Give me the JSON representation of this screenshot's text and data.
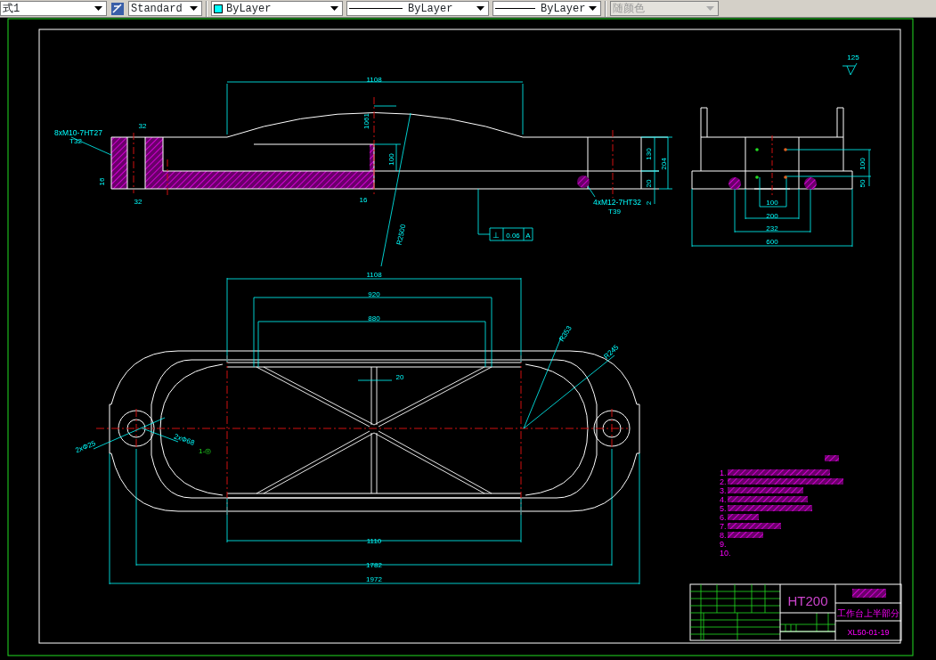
{
  "toolbar": {
    "dropdowns": [
      {
        "kind": "text",
        "value": "式1",
        "disabled": false
      },
      {
        "kind": "style",
        "value": "Standard",
        "disabled": false
      },
      {
        "kind": "color",
        "value": "ByLayer",
        "disabled": false
      },
      {
        "kind": "linetype",
        "value": "ByLayer",
        "disabled": false
      },
      {
        "kind": "lineweight",
        "value": "ByLayer",
        "disabled": false
      },
      {
        "kind": "plotstyle",
        "value": "随颜色",
        "disabled": true
      }
    ]
  },
  "drawing": {
    "side_view_labels": [
      "1108",
      "1061",
      "100",
      "130",
      "204",
      "20",
      "2",
      "8xM10-7HT27",
      "T32",
      "32",
      "16",
      "32",
      "16",
      "4xM12-7HT32",
      "T39",
      "R2500"
    ],
    "tolerance_frame": {
      "symbol": "⊥",
      "value": "0.06",
      "datum": "A"
    },
    "end_view_labels": [
      "125",
      "100",
      "50",
      "100",
      "200",
      "232",
      "600"
    ],
    "plan_view_labels": [
      "1108",
      "920",
      "880",
      "20",
      "R353",
      "R245",
      "1110",
      "1782",
      "1972",
      "2xΦ25",
      "2xΦ68",
      "1-◎"
    ],
    "technical_requirements": [
      "1.",
      "2.",
      "3.",
      "4.",
      "5.",
      "6.",
      "7.",
      "8.",
      "9.",
      "10."
    ],
    "title_block": {
      "material": "HT200",
      "part_name": "工作台上半部分",
      "drawing_number": "XL50-01-19"
    }
  }
}
